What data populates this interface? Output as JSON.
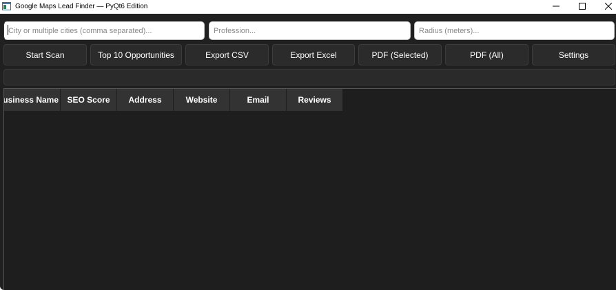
{
  "window": {
    "title": "Google Maps Lead Finder — PyQt6 Edition",
    "icon": "app-window-icon",
    "controls": [
      "minimize-icon",
      "maximize-icon",
      "close-icon"
    ]
  },
  "inputs": {
    "city": {
      "value": "",
      "placeholder": "City or multiple cities (comma separated)..."
    },
    "profession": {
      "value": "",
      "placeholder": "Profession..."
    },
    "radius": {
      "value": "",
      "placeholder": "Radius (meters)..."
    }
  },
  "toolbar": {
    "start_scan": "Start Scan",
    "top10": "Top 10 Opportunities",
    "export_csv": "Export CSV",
    "export_excel": "Export Excel",
    "pdf_selected": "PDF (Selected)",
    "pdf_all": "PDF (All)",
    "settings": "Settings"
  },
  "progress": {
    "value": 0
  },
  "table": {
    "columns": [
      "Business Name",
      "SEO Score",
      "Address",
      "Website",
      "Email",
      "Reviews"
    ],
    "rows": []
  },
  "colors": {
    "background": "#202020",
    "button": "#2b2b2b",
    "header": "#333333",
    "text": "#ffffff"
  }
}
